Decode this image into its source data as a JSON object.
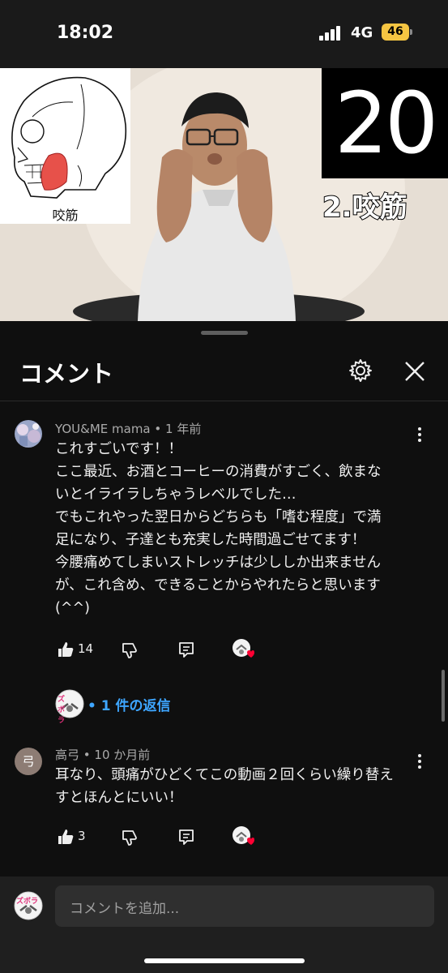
{
  "status_bar": {
    "time": "18:02",
    "network": "4G",
    "battery": "46"
  },
  "video": {
    "skull_label": "咬筋",
    "number": "20",
    "muscle_label": "2.咬筋"
  },
  "sheet": {
    "title": "コメント"
  },
  "comments": [
    {
      "author": "YOU&ME mama",
      "time": "1 年前",
      "lines": [
        "これすごいです！！",
        "ここ最近、お酒とコーヒーの消費がすごく、飲まな",
        "いとイライラしちゃうレベルでした…",
        "でもこれやった翌日からどちらも「嗜む程度」で満",
        "足になり、子達とも充実した時間過ごせてます！",
        "今腰痛めてしまいストレッチは少ししか出来ません",
        "が、これ含め、できることからやれたらと思います",
        "(^^)"
      ],
      "likes": "14"
    },
    {
      "author": "高弓",
      "avatar_letter": "弓",
      "time": "10 か月前",
      "lines": [
        "耳なり、頭痛がひどくてこの動画２回くらい繰り替え",
        "すとほんとにいい！"
      ],
      "likes": "3"
    }
  ],
  "replies": {
    "label": "• 1 件の返信"
  },
  "creator_avatar_text": "ズボラ",
  "input": {
    "placeholder": "コメントを追加..."
  },
  "colors": {
    "link": "#3ea6ff",
    "heart": "#ff0033",
    "battery": "#f5c542"
  }
}
